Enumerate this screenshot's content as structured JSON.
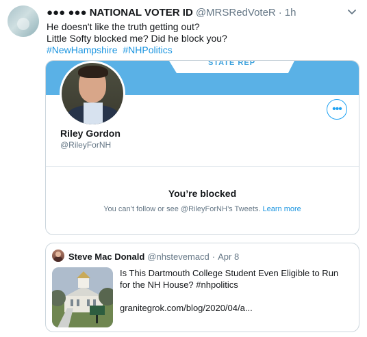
{
  "tweet": {
    "author": {
      "display_name": "●●● ●●● NATIONAL VOTER ID",
      "handle": "@MRSRedVoteR",
      "separator": "·",
      "time": "1h",
      "avatar_icon": "user-avatar-icon"
    },
    "text": {
      "line1": "He doesn't like the truth getting out?",
      "line2": "Little Softy blocked me? Did he block you?",
      "hashtags": [
        "#NewHampshire",
        "#NHPolitics"
      ]
    },
    "caret_icon": "chevron-down-icon"
  },
  "blocked_card": {
    "banner_text": "STATE REP",
    "name": "Riley Gordon",
    "handle": "@RileyForNH",
    "more_icon": "more-options-icon",
    "title": "You’re blocked",
    "message": "You can’t follow or see @RileyForNH’s Tweets.",
    "learn_more": "Learn more"
  },
  "quoted_tweet": {
    "author_name": "Steve Mac Donald",
    "author_handle": "@nhstevemacd",
    "separator": "·",
    "date": "Apr 8",
    "text_line1": "Is This Dartmouth College Student Even Eligible to Run",
    "text_line2": "for the NH House? #nhpolitics",
    "link": "granitegrok.com/blog/2020/04/a...",
    "thumb_icon": "building-photo-icon"
  },
  "colors": {
    "accent": "#1da1f2",
    "link": "#1b95e0",
    "muted": "#657786",
    "border": "#ccd6dd",
    "banner": "#5ab1e6"
  }
}
